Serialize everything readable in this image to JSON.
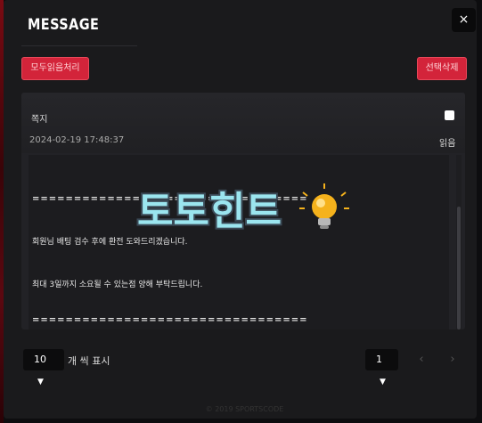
{
  "modal": {
    "title": "MESSAGE",
    "close_label": "×"
  },
  "toolbar": {
    "mark_all_read_label": "모두읽음처리",
    "delete_selected_label": "선택삭제"
  },
  "message": {
    "kind": "쪽지",
    "date": "2024-02-19 17:48:37",
    "status": "읽음",
    "lines": [
      "=================================",
      "회원님 배팅 검수 후에 환전 도와드리겠습니다.",
      "최대 3일까지 소요될 수 있는점 양해 부탁드립니다.",
      "================================="
    ]
  },
  "watermark": {
    "text": "토토힌트"
  },
  "pagination": {
    "per_page_value": "10",
    "per_page_suffix": "개 씩 표시",
    "current_page": "1",
    "prev_icon": "‹",
    "next_icon": "›"
  },
  "footer": {
    "text": "© 2019 SPORTSCODE"
  }
}
